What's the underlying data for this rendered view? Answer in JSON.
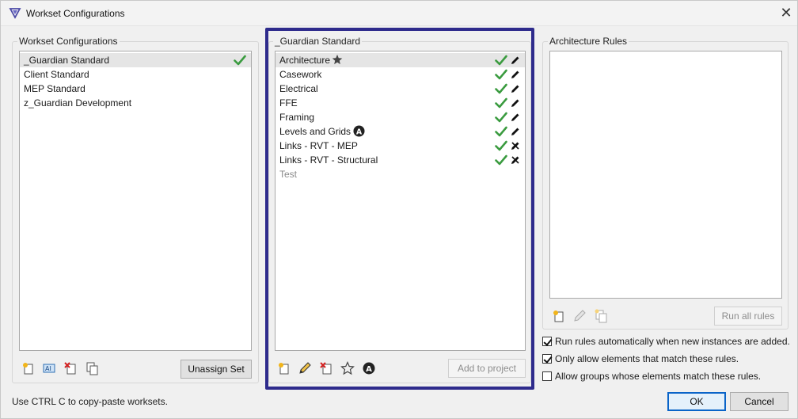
{
  "window": {
    "title": "Workset Configurations",
    "close_glyph": "✕"
  },
  "left_panel": {
    "label": "Workset Configurations",
    "items": [
      {
        "label": "_Guardian Standard",
        "selected": true,
        "checked": true
      },
      {
        "label": "Client Standard"
      },
      {
        "label": "MEP Standard"
      },
      {
        "label": "z_Guardian Development"
      }
    ],
    "toolbar_icons": [
      "new-icon",
      "rename-icon",
      "delete-icon",
      "copy-icon"
    ],
    "unassign_label": "Unassign Set"
  },
  "middle_panel": {
    "label": "_Guardian Standard",
    "items": [
      {
        "label": "Architecture",
        "selected": true,
        "star": true,
        "edit": "edit"
      },
      {
        "label": "Casework",
        "edit": "edit"
      },
      {
        "label": "Electrical",
        "edit": "edit"
      },
      {
        "label": "FFE",
        "edit": "edit"
      },
      {
        "label": "Framing",
        "edit": "edit"
      },
      {
        "label": "Levels and Grids",
        "badge": "A",
        "edit": "edit"
      },
      {
        "label": "Links - RVT - MEP",
        "edit": "no-edit"
      },
      {
        "label": "Links - RVT - Structural",
        "edit": "no-edit"
      },
      {
        "label": "Test",
        "disabled": true
      }
    ],
    "toolbar_icons": [
      "new-icon",
      "pencil-icon",
      "delete-icon",
      "star-icon",
      "badge-a-icon"
    ],
    "add_label": "Add to project"
  },
  "right_panel": {
    "label": "Architecture Rules",
    "toolbar_icons": [
      "new-icon",
      "pencil-icon",
      "copy-icon"
    ],
    "run_all_label": "Run all rules"
  },
  "options": [
    {
      "label": "Run rules automatically when new instances are added.",
      "checked": true
    },
    {
      "label": "Only allow elements that match these rules.",
      "checked": true
    },
    {
      "label": "Allow groups whose elements match these rules.",
      "checked": false
    }
  ],
  "footer": {
    "hint": "Use CTRL C to copy-paste worksets.",
    "ok_label": "OK",
    "cancel_label": "Cancel"
  },
  "colors": {
    "accent_frame": "#2e2b8c",
    "check": "#3a9b3f",
    "ok_border": "#0a64c8"
  }
}
